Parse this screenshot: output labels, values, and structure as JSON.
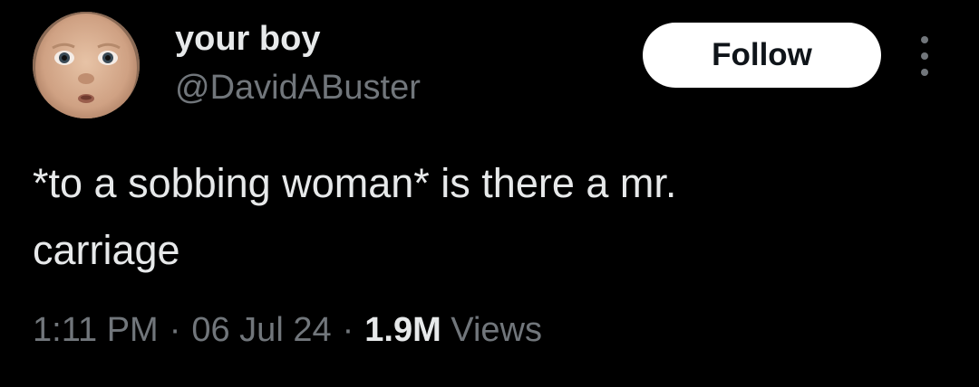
{
  "author": {
    "display_name": "your boy",
    "handle": "@DavidABuster",
    "avatar_icon": "baby-face-avatar"
  },
  "actions": {
    "follow_label": "Follow",
    "more_icon": "more-vertical-icon"
  },
  "tweet": {
    "lines": [
      "*to a sobbing woman* is there a mr.",
      "carriage"
    ]
  },
  "meta": {
    "time": "1:11 PM",
    "separator": "·",
    "date": "06 Jul 24",
    "views_count": "1.9M",
    "views_label": "Views"
  },
  "colors": {
    "background": "#000000",
    "primary_text": "#e7e9ea",
    "secondary_text": "#71767b",
    "follow_button_bg": "#ffffff",
    "follow_button_text": "#0f1419"
  }
}
